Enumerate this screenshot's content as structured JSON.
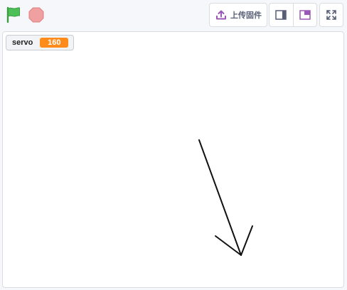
{
  "toolbar": {
    "upload_label": "上传固件",
    "accent": "#4cbf56",
    "stop_color": "#ec9c9c"
  },
  "stage": {
    "monitor": {
      "name": "servo",
      "value": "160",
      "value_color": "#ff8c1a"
    }
  }
}
